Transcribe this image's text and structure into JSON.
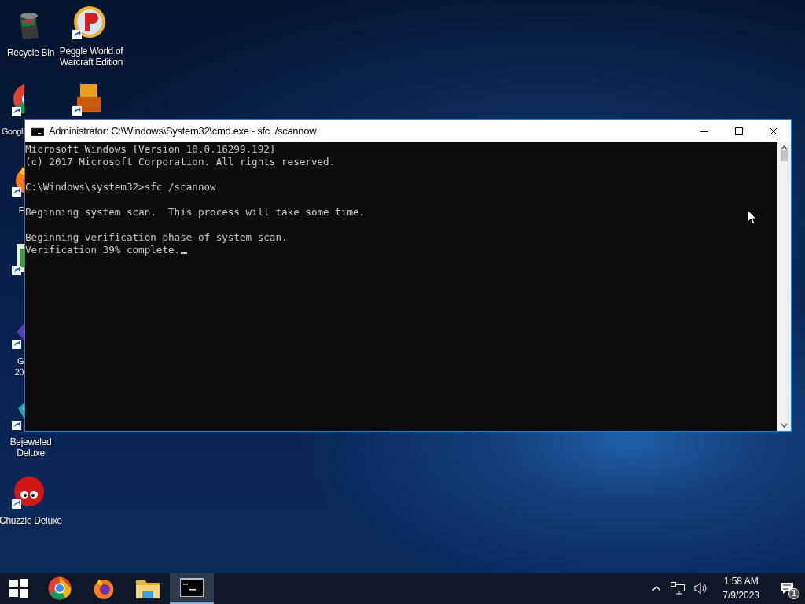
{
  "desktop_icons": [
    {
      "kind": "recycle",
      "label_lines": [
        "Recycle Bin"
      ],
      "shortcut": false
    },
    {
      "kind": "peggle",
      "label_lines": [
        "Peggle World of",
        "Warcraft Edition"
      ],
      "shortcut": true
    },
    {
      "kind": "chrome",
      "label_lines": [
        "Googl"
      ],
      "shortcut": true
    },
    {
      "kind": "blocks",
      "shortcut": true
    },
    {
      "kind": "firefox",
      "label_lines": [
        "F"
      ],
      "shortcut": true
    },
    {
      "kind": "letter",
      "shortcut": true
    },
    {
      "kind": "purple",
      "label_lines": [
        "G",
        "20"
      ],
      "shortcut": true
    },
    {
      "kind": "gem",
      "label_lines": [
        "Bejeweled",
        "Deluxe"
      ],
      "shortcut": true
    },
    {
      "kind": "fuzzball",
      "label_lines": [
        "Chuzzle Deluxe"
      ],
      "shortcut": true
    }
  ],
  "window": {
    "title": "Administrator: C:\\Windows\\System32\\cmd.exe - sfc  /scannow",
    "console": {
      "blocks": [
        [
          "Microsoft Windows [Version 10.0.16299.192]",
          "(c) 2017 Microsoft Corporation. All rights reserved."
        ],
        [
          "C:\\Windows\\system32>sfc /scannow"
        ],
        [
          "Beginning system scan.  This process will take some time."
        ],
        [
          "Beginning verification phase of system scan.",
          "Verification 39% complete."
        ]
      ],
      "cursor": true
    }
  },
  "taskbar": {
    "apps": [
      {
        "kind": "start",
        "selected": false
      },
      {
        "kind": "chrome",
        "selected": false
      },
      {
        "kind": "firefox",
        "selected": false
      },
      {
        "kind": "folder",
        "selected": false
      },
      {
        "kind": "cmd",
        "selected": true
      }
    ],
    "time": "1:58 AM",
    "date": "7/9/2023",
    "notification_count": "1"
  }
}
